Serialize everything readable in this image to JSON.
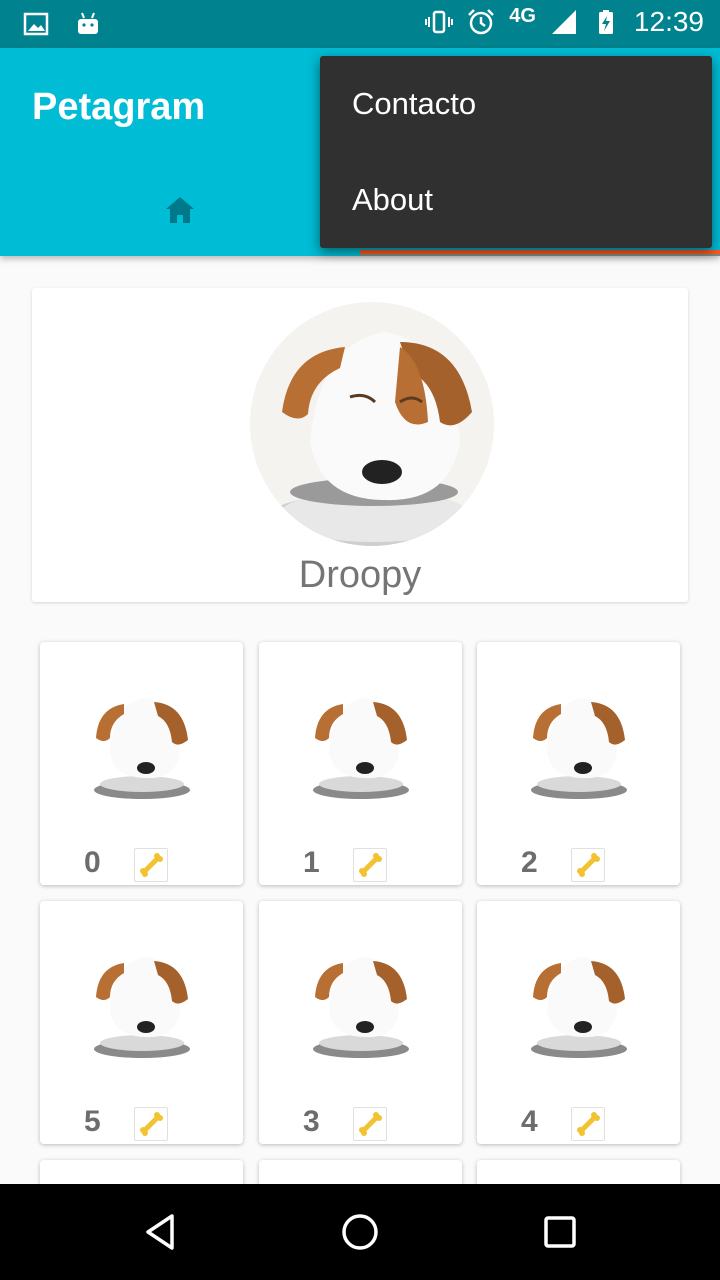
{
  "status_bar": {
    "time": "12:39",
    "network": "4G",
    "icons": [
      "image-icon",
      "android-icon",
      "vibrate-icon",
      "alarm-icon",
      "signal-icon",
      "battery-charging-icon"
    ]
  },
  "app_bar": {
    "title": "Petagram",
    "tabs": [
      {
        "icon": "home-icon",
        "selected": false
      },
      {
        "icon": "",
        "selected": true
      }
    ]
  },
  "overflow_menu": {
    "items": [
      {
        "label": "Contacto"
      },
      {
        "label": "About"
      }
    ]
  },
  "profile": {
    "name": "Droopy"
  },
  "pets": [
    {
      "rating": "0"
    },
    {
      "rating": "1"
    },
    {
      "rating": "2"
    },
    {
      "rating": "5"
    },
    {
      "rating": "3"
    },
    {
      "rating": "4"
    }
  ],
  "colors": {
    "primary": "#00bcd4",
    "primary_dark": "#00838f",
    "accent": "#ff5722",
    "menu_bg": "#303030"
  },
  "nav_bar": {
    "icons": [
      "back-icon",
      "home-circle-icon",
      "recents-icon"
    ]
  }
}
